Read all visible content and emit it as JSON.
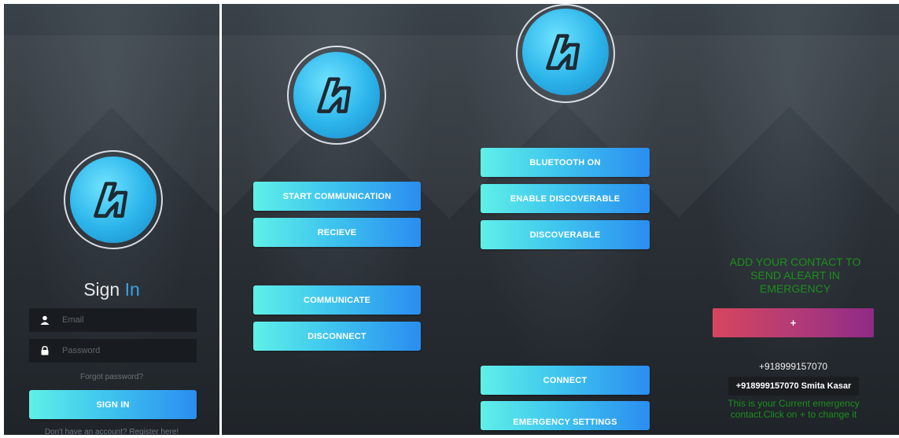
{
  "login": {
    "title_part1": "Sign",
    "title_part2": "In",
    "email_placeholder": "Email",
    "password_placeholder": "Password",
    "forgot_password": "Forgot password?",
    "sign_in_button": "SIGN IN",
    "register_text": "Don't have an account? Register here!"
  },
  "communication": {
    "start_button": "START COMMUNICATION",
    "receive_button": "RECIEVE",
    "communicate_button": "COMMUNICATE",
    "disconnect_button": "DISCONNECT"
  },
  "bluetooth": {
    "bluetooth_on_button": "BLUETOOTH ON",
    "enable_discoverable_button": "ENABLE DISCOVERABLE",
    "discoverable_button": "DISCOVERABLE",
    "connect_button": "CONNECT",
    "emergency_settings_button": "EMERGENCY SETTINGS"
  },
  "emergency": {
    "heading": "ADD YOUR CONTACT TO SEND ALEART IN EMERGENCY",
    "add_button": "+",
    "phone_number": "+918999157070",
    "current_contact": "+918999157070 Smita Kasar",
    "info_text": "This is your Current emergency contact.Click on + to change it"
  },
  "colors": {
    "button_gradient_start": "#5ff0e8",
    "button_gradient_end": "#2a8df0",
    "accent_blue": "#3aa3e8",
    "emergency_green": "#1d8f1d",
    "plus_gradient_start": "#d6455e",
    "plus_gradient_end": "#8f2a86"
  },
  "icons": {
    "app_logo": "app-logo-icon",
    "email": "user-icon",
    "password": "lock-icon"
  }
}
